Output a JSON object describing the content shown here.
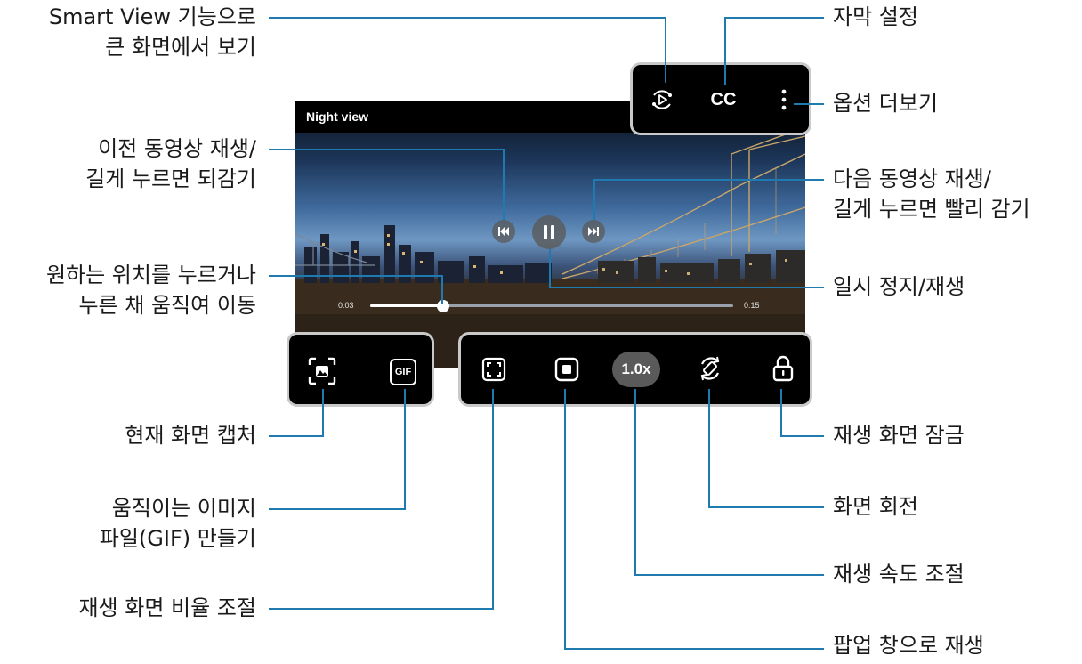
{
  "video": {
    "title": "Night view",
    "current_time": "0:03",
    "total_time": "0:15",
    "progress": 0.2,
    "speed_label": "1.0x",
    "cc_label": "CC",
    "gif_label": "GIF"
  },
  "callouts": {
    "smart_view": [
      "Smart View 기능으로",
      "큰 화면에서 보기"
    ],
    "subtitle": [
      "자막 설정"
    ],
    "more_options": [
      "옵션 더보기"
    ],
    "prev_video": [
      "이전 동영상 재생/",
      "길게 누르면 되감기"
    ],
    "next_video": [
      "다음 동영상 재생/",
      "길게 누르면 빨리 감기"
    ],
    "seek": [
      "원하는 위치를 누르거나",
      "누른 채 움직여 이동"
    ],
    "pause": [
      "일시 정지/재생"
    ],
    "capture": [
      "현재 화면 캡처"
    ],
    "gif": [
      "움직이는 이미지",
      "파일(GIF) 만들기"
    ],
    "ratio": [
      "재생 화면 비율 조절"
    ],
    "lock": [
      "재생 화면 잠금"
    ],
    "rotate": [
      "화면 회전"
    ],
    "speed": [
      "재생 속도 조절"
    ],
    "popup": [
      "팝업 창으로 재생"
    ]
  },
  "colors": {
    "leader_line": "#1f7ab0",
    "panel_border": "#c9c9c9"
  }
}
